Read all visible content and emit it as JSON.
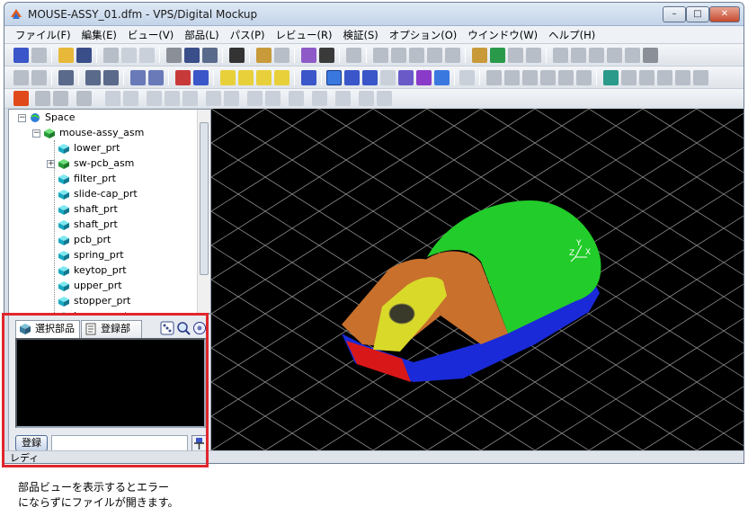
{
  "window": {
    "title": "MOUSE-ASSY_01.dfm - VPS/Digital Mockup",
    "app_icon": "vps-app-icon",
    "controls": {
      "minimize": "–",
      "maximize": "□",
      "close": "✕"
    }
  },
  "menu": [
    "ファイル(F)",
    "編集(E)",
    "ビュー(V)",
    "部品(L)",
    "パス(P)",
    "レビュー(R)",
    "検証(S)",
    "オプション(O)",
    "ウインドウ(W)",
    "ヘルプ(H)"
  ],
  "tree": {
    "root": "Space",
    "assembly": "mouse-assy_asm",
    "parts": [
      "lower_prt",
      "sw-pcb_asm",
      "filter_prt",
      "slide-cap_prt",
      "shaft_prt",
      "shaft_prt",
      "pcb_prt",
      "spring_prt",
      "keytop_prt",
      "upper_prt",
      "stopper_prt",
      "keycap_prt"
    ]
  },
  "parts_view": {
    "tab_selected": "選択部品",
    "tab_registered": "登録部品",
    "register_label": "登録",
    "register_value": ""
  },
  "status": {
    "text": "レディ"
  },
  "caption": {
    "line1": "部品ビューを表示するとエラー",
    "line2": "にならずにファイルが開きます。"
  },
  "colors": {
    "highlight": "#e0262d",
    "mouse_top": "#22cc2a",
    "mouse_base": "#1a2ad8",
    "mouse_button": "#c8702c",
    "mouse_wheel_cover": "#d9d92a",
    "mouse_front": "#d81818",
    "part_icon": "#1ec8d8"
  }
}
